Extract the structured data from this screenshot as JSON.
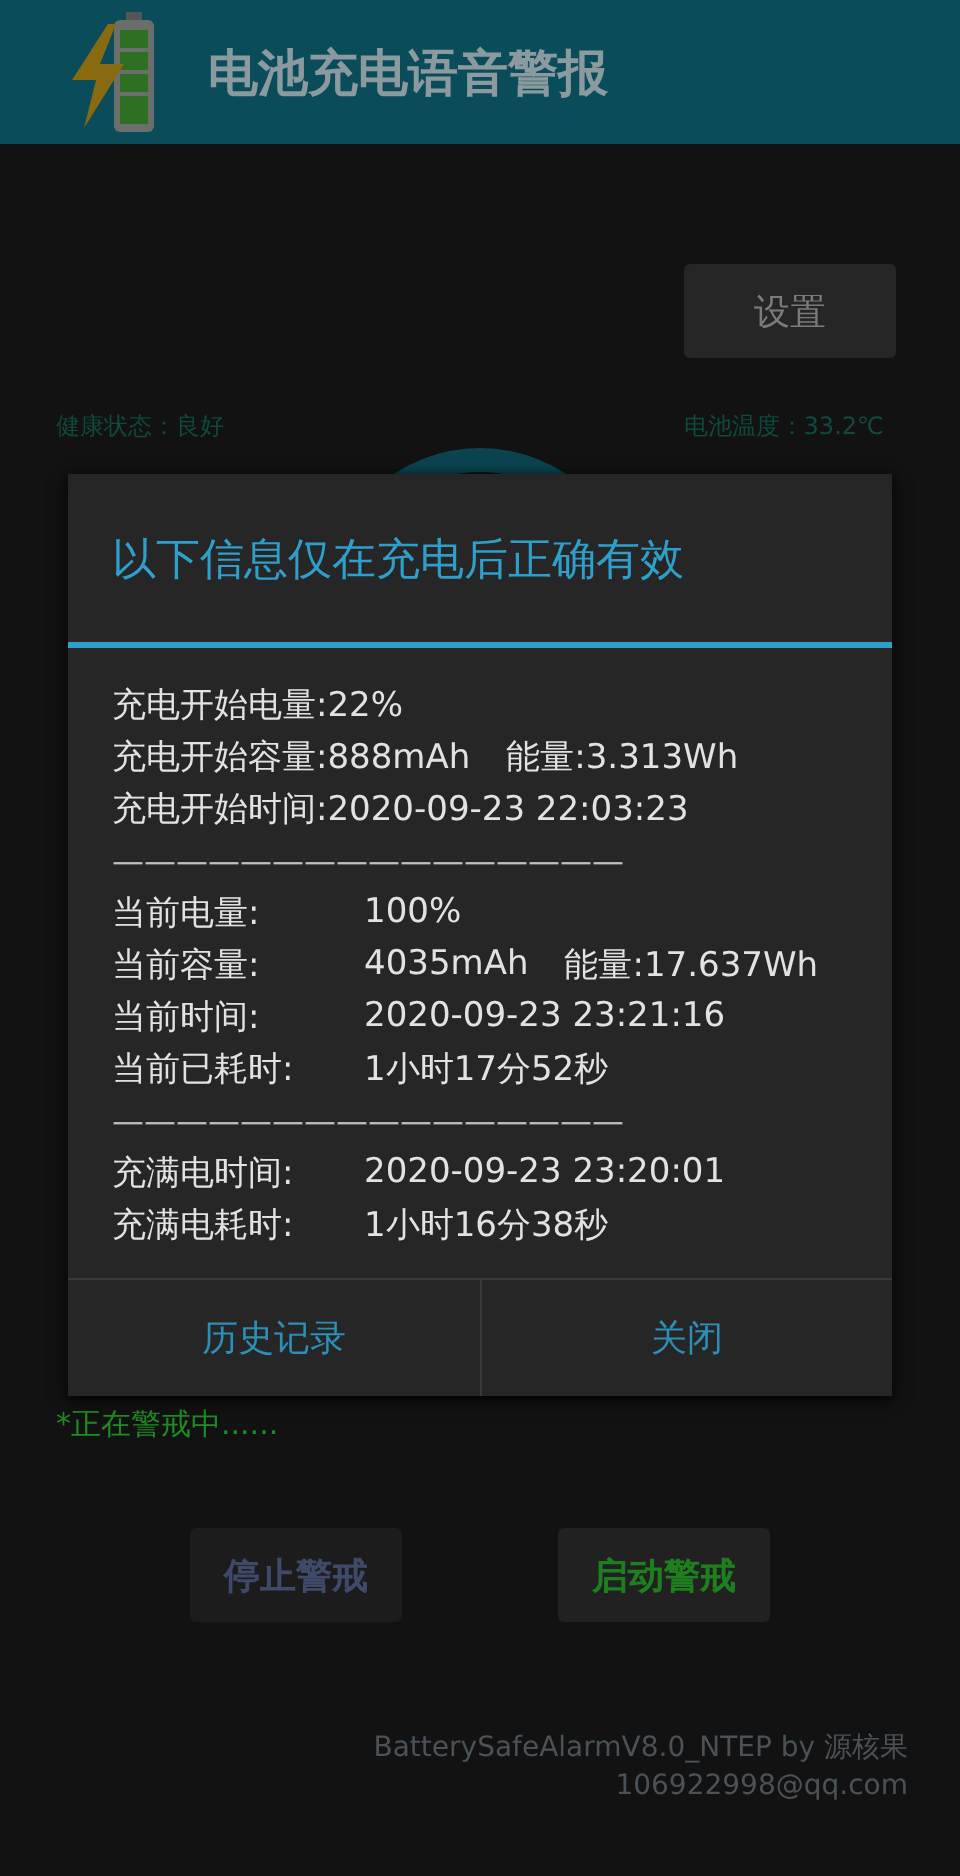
{
  "app_bar": {
    "title": "电池充电语音警报"
  },
  "settings_button": {
    "label": "设置"
  },
  "health_status": "健康状态：良好",
  "battery_temperature": "电池温度：33.2℃",
  "alarm_status": "*正在警戒中......",
  "buttons": [
    {
      "label": "停止警戒",
      "kind": "stop",
      "disabled": true
    },
    {
      "label": "启动警戒",
      "kind": "start",
      "disabled": false
    }
  ],
  "credits": [
    "BatterySafeAlarmV8.0_NTEP by 源核果",
    "106922998@qq.com"
  ],
  "dialog": {
    "title": "以下信息仅在充电后正确有效",
    "rows": [
      {
        "kind": "line",
        "text": "充电开始电量:22%"
      },
      {
        "kind": "line",
        "text": "充电开始容量:888mAh",
        "extra": "能量:3.313Wh"
      },
      {
        "kind": "line",
        "text": "充电开始时间:2020-09-23 22:03:23"
      },
      {
        "kind": "separator",
        "text": "————————————————"
      },
      {
        "kind": "pair",
        "label": "当前电量:",
        "value": "100%"
      },
      {
        "kind": "pair",
        "label": "当前容量:",
        "value": "4035mAh",
        "extra": "能量:17.637Wh"
      },
      {
        "kind": "pair",
        "label": "当前时间:",
        "value": "2020-09-23 23:21:16"
      },
      {
        "kind": "pair",
        "label": "当前已耗时:",
        "value": "1小时17分52秒"
      },
      {
        "kind": "separator",
        "text": "————————————————"
      },
      {
        "kind": "pair",
        "label": "充满电时间:",
        "value": "2020-09-23 23:20:01"
      },
      {
        "kind": "pair",
        "label": "充满电耗时:",
        "value": "1小时16分38秒"
      }
    ],
    "buttons": [
      "历史记录",
      "关闭"
    ]
  }
}
